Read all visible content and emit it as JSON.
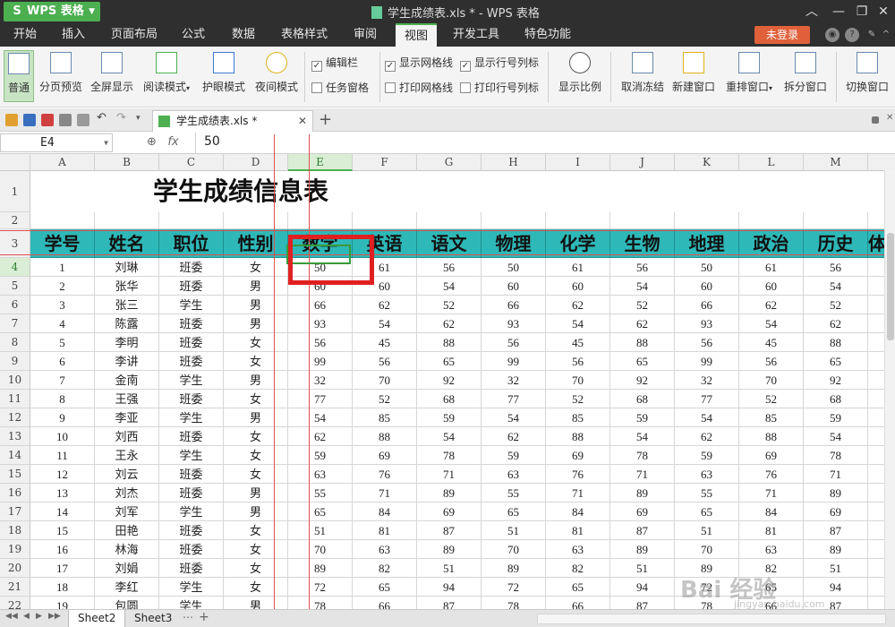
{
  "titlebar": {
    "app_name": "WPS 表格",
    "window_title": "学生成绩表.xls * - WPS 表格"
  },
  "menu": [
    "开始",
    "插入",
    "页面布局",
    "公式",
    "数据",
    "表格样式",
    "审阅",
    "视图",
    "开发工具",
    "特色功能"
  ],
  "menu_active": "视图",
  "login_label": "未登录",
  "ribbon": {
    "views": [
      "普通",
      "分页预览",
      "全屏显示",
      "阅读模式",
      "护眼模式",
      "夜间模式"
    ],
    "checks": [
      {
        "label": "编辑栏",
        "checked": true
      },
      {
        "label": "任务窗格",
        "checked": false
      },
      {
        "label": "显示网格线",
        "checked": true
      },
      {
        "label": "显示行号列标",
        "checked": true
      },
      {
        "label": "打印网格线",
        "checked": false
      },
      {
        "label": "打印行号列标",
        "checked": false
      }
    ],
    "zoom_label": "显示比例",
    "actions": [
      "取消冻结",
      "新建窗口",
      "重排窗口",
      "拆分窗口",
      "切换窗口"
    ]
  },
  "doc_tab": "学生成绩表.xls *",
  "formula": {
    "cell_ref": "E4",
    "fx": "fx",
    "value": "50"
  },
  "columns": [
    "A",
    "B",
    "C",
    "D",
    "E",
    "F",
    "G",
    "H",
    "I",
    "J",
    "K",
    "L",
    "M"
  ],
  "active_column": "E",
  "sheet_title": "学生成绩信息表",
  "headers": [
    "学号",
    "姓名",
    "职位",
    "性别",
    "数学",
    "英语",
    "语文",
    "物理",
    "化学",
    "生物",
    "地理",
    "政治",
    "历史",
    "体"
  ],
  "rows": [
    {
      "rn": "4",
      "cells": [
        "1",
        "刘琳",
        "班委",
        "女",
        "50",
        "61",
        "56",
        "50",
        "61",
        "56",
        "50",
        "61",
        "56"
      ]
    },
    {
      "rn": "5",
      "cells": [
        "2",
        "张华",
        "班委",
        "男",
        "60",
        "60",
        "54",
        "60",
        "60",
        "54",
        "60",
        "60",
        "54"
      ]
    },
    {
      "rn": "6",
      "cells": [
        "3",
        "张三",
        "学生",
        "男",
        "66",
        "62",
        "52",
        "66",
        "62",
        "52",
        "66",
        "62",
        "52"
      ]
    },
    {
      "rn": "7",
      "cells": [
        "4",
        "陈露",
        "班委",
        "男",
        "93",
        "54",
        "62",
        "93",
        "54",
        "62",
        "93",
        "54",
        "62"
      ]
    },
    {
      "rn": "8",
      "cells": [
        "5",
        "李明",
        "班委",
        "女",
        "56",
        "45",
        "88",
        "56",
        "45",
        "88",
        "56",
        "45",
        "88"
      ]
    },
    {
      "rn": "9",
      "cells": [
        "6",
        "李讲",
        "班委",
        "女",
        "99",
        "56",
        "65",
        "99",
        "56",
        "65",
        "99",
        "56",
        "65"
      ]
    },
    {
      "rn": "10",
      "cells": [
        "7",
        "金南",
        "学生",
        "男",
        "32",
        "70",
        "92",
        "32",
        "70",
        "92",
        "32",
        "70",
        "92"
      ]
    },
    {
      "rn": "11",
      "cells": [
        "8",
        "王强",
        "班委",
        "女",
        "77",
        "52",
        "68",
        "77",
        "52",
        "68",
        "77",
        "52",
        "68"
      ]
    },
    {
      "rn": "12",
      "cells": [
        "9",
        "李亚",
        "学生",
        "男",
        "54",
        "85",
        "59",
        "54",
        "85",
        "59",
        "54",
        "85",
        "59"
      ]
    },
    {
      "rn": "13",
      "cells": [
        "10",
        "刘西",
        "班委",
        "女",
        "62",
        "88",
        "54",
        "62",
        "88",
        "54",
        "62",
        "88",
        "54"
      ]
    },
    {
      "rn": "14",
      "cells": [
        "11",
        "王永",
        "学生",
        "女",
        "59",
        "69",
        "78",
        "59",
        "69",
        "78",
        "59",
        "69",
        "78"
      ]
    },
    {
      "rn": "15",
      "cells": [
        "12",
        "刘云",
        "班委",
        "女",
        "63",
        "76",
        "71",
        "63",
        "76",
        "71",
        "63",
        "76",
        "71"
      ]
    },
    {
      "rn": "16",
      "cells": [
        "13",
        "刘杰",
        "班委",
        "男",
        "55",
        "71",
        "89",
        "55",
        "71",
        "89",
        "55",
        "71",
        "89"
      ]
    },
    {
      "rn": "17",
      "cells": [
        "14",
        "刘军",
        "学生",
        "男",
        "65",
        "84",
        "69",
        "65",
        "84",
        "69",
        "65",
        "84",
        "69"
      ]
    },
    {
      "rn": "18",
      "cells": [
        "15",
        "田艳",
        "班委",
        "女",
        "51",
        "81",
        "87",
        "51",
        "81",
        "87",
        "51",
        "81",
        "87"
      ]
    },
    {
      "rn": "19",
      "cells": [
        "16",
        "林海",
        "班委",
        "女",
        "70",
        "63",
        "89",
        "70",
        "63",
        "89",
        "70",
        "63",
        "89"
      ]
    },
    {
      "rn": "20",
      "cells": [
        "17",
        "刘娟",
        "班委",
        "女",
        "89",
        "82",
        "51",
        "89",
        "82",
        "51",
        "89",
        "82",
        "51"
      ]
    },
    {
      "rn": "21",
      "cells": [
        "18",
        "李红",
        "学生",
        "女",
        "72",
        "65",
        "94",
        "72",
        "65",
        "94",
        "72",
        "65",
        "94"
      ]
    },
    {
      "rn": "22",
      "cells": [
        "19",
        "包圆",
        "学生",
        "男",
        "78",
        "66",
        "87",
        "78",
        "66",
        "87",
        "78",
        "66",
        "87"
      ]
    }
  ],
  "sheet_tabs": [
    "Sheet2",
    "Sheet3"
  ],
  "active_sheet": "Sheet2",
  "watermark": "Bai 经验",
  "watermark_sub": "jingyan.baidu.com"
}
